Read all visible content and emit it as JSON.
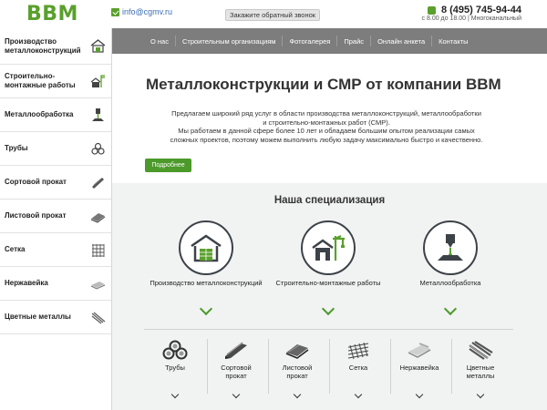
{
  "header": {
    "logo": "BBM",
    "email": "info@cgmv.ru",
    "callback_label": "Закажите обратный звонок",
    "phone": "8 (495) 745-94-44",
    "hours": "с 8.00 до 18.00 | Многоканальный"
  },
  "sidebar": {
    "items": [
      {
        "label": "Производство металлоконструкций",
        "icon": "warehouse-icon"
      },
      {
        "label": "Строительно-монтажные работы",
        "icon": "crane-icon"
      },
      {
        "label": "Металлообработка",
        "icon": "laser-icon"
      },
      {
        "label": "Трубы",
        "icon": "pipes-icon"
      },
      {
        "label": "Сортовой прокат",
        "icon": "channel-icon"
      },
      {
        "label": "Листовой прокат",
        "icon": "sheet-icon"
      },
      {
        "label": "Сетка",
        "icon": "mesh-icon"
      },
      {
        "label": "Нержавейка",
        "icon": "stainless-icon"
      },
      {
        "label": "Цветные металлы",
        "icon": "rods-icon"
      }
    ]
  },
  "nav": {
    "items": [
      "О нас",
      "Строительным организациям",
      "Фотогалерея",
      "Прайс",
      "Онлайн анкета",
      "Контакты"
    ]
  },
  "hero": {
    "title": "Металлоконструкции и СМР от компании BBM",
    "text_line1": "Предлагаем широкий ряд услуг в области производства металлоконструкций,  металлообработки",
    "text_line2": "и строительно-монтажных работ (СМР).",
    "text_line3": "Мы работаем в данной сфере более 10 лет и обладаем большим опытом реализации самых",
    "text_line4": "сложных проектов, поэтому можем выполнить любую задачу максимально быстро и качественно.",
    "button_label": "Подробнее"
  },
  "specialization": {
    "title": "Наша специализация",
    "cards": [
      {
        "label": "Производство металлоконструкций",
        "icon": "warehouse-icon"
      },
      {
        "label": "Строительно-монтажные работы",
        "icon": "crane-icon"
      },
      {
        "label": "Металлообработка",
        "icon": "laser-icon"
      }
    ],
    "products": [
      {
        "label": "Трубы",
        "label2": "",
        "icon": "pipes-icon"
      },
      {
        "label": "Сортовой",
        "label2": "прокат",
        "icon": "channel-icon"
      },
      {
        "label": "Листовой",
        "label2": "прокат",
        "icon": "sheet-icon"
      },
      {
        "label": "Сетка",
        "label2": "",
        "icon": "mesh-icon"
      },
      {
        "label": "Нержавейка",
        "label2": "",
        "icon": "stainless-icon"
      },
      {
        "label": "Цветные",
        "label2": "металлы",
        "icon": "rods-icon"
      }
    ]
  },
  "colors": {
    "accent": "#5aa02c",
    "button": "#4b9a2a",
    "nav": "#7d7d7d",
    "section_bg": "#f1f2f2"
  }
}
